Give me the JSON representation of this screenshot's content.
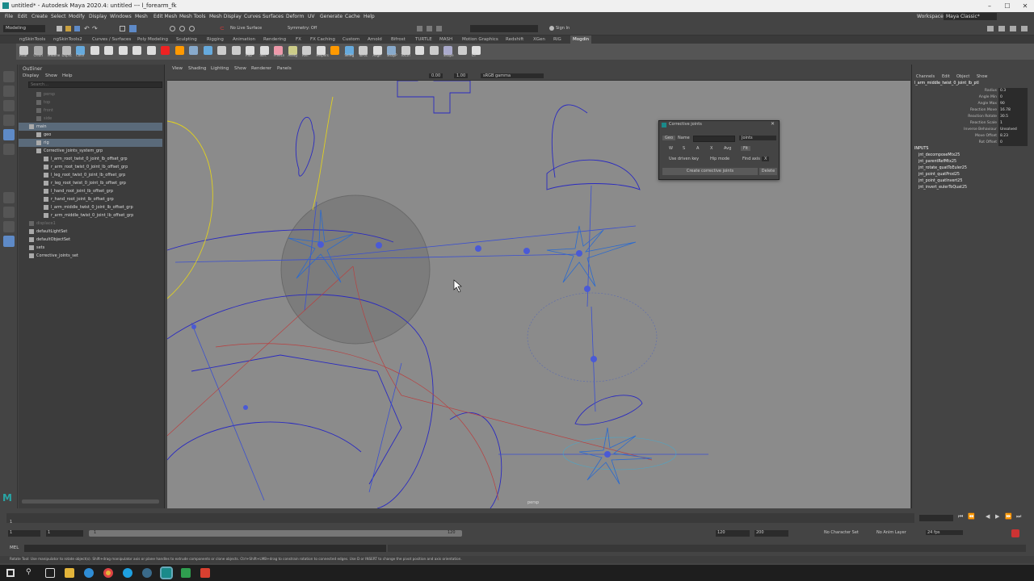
{
  "window": {
    "title": "untitled* - Autodesk Maya 2020.4: untitled   ---   l_forearm_fk",
    "minimize": "–",
    "maximize": "☐",
    "close": "✕"
  },
  "menu": [
    "File",
    "Edit",
    "Create",
    "Select",
    "Modify",
    "Display",
    "Windows",
    "Mesh",
    "Edit Mesh",
    "Mesh Tools",
    "Mesh Display",
    "Curves",
    "Surfaces",
    "Deform",
    "UV",
    "Generate",
    "Cache",
    "Help"
  ],
  "workspace": {
    "label": "Workspace :",
    "value": "Maya Classic*"
  },
  "statusline": {
    "mode": "Modeling",
    "live_surface": "No Live Surface",
    "symmetry": "Symmetry: Off",
    "sign_in": "Sign In"
  },
  "shelf_tabs": [
    "ngSkinTools",
    "ngSkinTools2",
    "Curves / Surfaces",
    "Poly Modeling",
    "Sculpting",
    "Rigging",
    "Animation",
    "Rendering",
    "FX",
    "FX Caching",
    "Custom",
    "Arnold",
    "Bifrost",
    "TURTLE",
    "MASH",
    "Motion Graphics",
    "Redshift",
    "XGen",
    "RIG",
    "Mogdin"
  ],
  "shelf_labels": [
    "Pillar",
    "Clean",
    "MName",
    "Duplic",
    "Color",
    "",
    "",
    "",
    "",
    "",
    "",
    "",
    "",
    "",
    "",
    "",
    "PSD",
    "Sort",
    "FreeLn",
    "AlEdg",
    "Refl",
    "Helpers",
    "",
    "SelHg",
    "ToFoc",
    "Align",
    "SnapP",
    "ToCtrl",
    "",
    "",
    "Shape",
    "",
    "CT"
  ],
  "outliner": {
    "title": "Outliner",
    "menu": [
      "Display",
      "Show",
      "Help"
    ],
    "search_placeholder": "Search...",
    "rows": [
      {
        "indent": 2,
        "label": "persp",
        "dim": true
      },
      {
        "indent": 2,
        "label": "top",
        "dim": true
      },
      {
        "indent": 2,
        "label": "front",
        "dim": true
      },
      {
        "indent": 2,
        "label": "side",
        "dim": true
      },
      {
        "indent": 1,
        "label": "main",
        "selected": true
      },
      {
        "indent": 2,
        "label": "geo"
      },
      {
        "indent": 2,
        "label": "rig",
        "selected": true
      },
      {
        "indent": 2,
        "label": "Corrective_joints_system_grp"
      },
      {
        "indent": 3,
        "label": "l_arm_root_twist_0_joint_lb_offset_grp"
      },
      {
        "indent": 3,
        "label": "r_arm_root_twist_0_joint_lb_offset_grp"
      },
      {
        "indent": 3,
        "label": "l_leg_root_twist_0_joint_lb_offset_grp"
      },
      {
        "indent": 3,
        "label": "r_leg_root_twist_0_joint_lb_offset_grp"
      },
      {
        "indent": 3,
        "label": "l_hand_root_joint_lb_offset_grp"
      },
      {
        "indent": 3,
        "label": "r_hand_root_joint_lb_offset_grp"
      },
      {
        "indent": 3,
        "label": "l_arm_middle_twist_0_joint_lb_offset_grp"
      },
      {
        "indent": 3,
        "label": "r_arm_middle_twist_0_joint_lb_offset_grp"
      },
      {
        "indent": 1,
        "label": "displace1",
        "dim": true
      },
      {
        "indent": 1,
        "label": "defaultLightSet"
      },
      {
        "indent": 1,
        "label": "defaultObjectSet"
      },
      {
        "indent": 1,
        "label": "sets"
      },
      {
        "indent": 1,
        "label": "Corrective_joints_set"
      }
    ]
  },
  "viewport": {
    "menu": [
      "View",
      "Shading",
      "Lighting",
      "Show",
      "Renderer",
      "Panels"
    ],
    "value1": "0.00",
    "value2": "1.00",
    "colorspace": "sRGB gamma",
    "camera_label": "persp"
  },
  "dialog": {
    "title": "Corrective joints",
    "geo_btn": "Geo",
    "name_label": "Name",
    "name_value": "",
    "type_value": "Joints",
    "axes": [
      "W",
      "S",
      "A",
      "X",
      "Avg"
    ],
    "fit_btn": "Fit",
    "use_driven_key": "Use driven key",
    "hip_mode": "Hip mode",
    "find_axis_label": "Find axis",
    "find_axis_value": "X",
    "create_btn": "Create corrective joints",
    "delete_btn": "Delete"
  },
  "channelbox": {
    "menu": [
      "Channels",
      "Edit",
      "Object",
      "Show"
    ],
    "node_name": "l_arm_middle_twist_0_joint_lb_ptl",
    "attributes": [
      {
        "name": "Radius",
        "value": "0.3"
      },
      {
        "name": "Angle Min",
        "value": "0"
      },
      {
        "name": "Angle Max",
        "value": "90"
      },
      {
        "name": "Reaction Move",
        "value": "16.78"
      },
      {
        "name": "Reaction Rotate",
        "value": "30.5"
      },
      {
        "name": "Reaction Scale",
        "value": "1"
      },
      {
        "name": "Inverse Behaviour",
        "value": "Unsolved"
      },
      {
        "name": "Move Offset",
        "value": "8.23"
      },
      {
        "name": "Rot Offset",
        "value": "0"
      }
    ],
    "inputs_title": "INPUTS",
    "inputs": [
      "jnt_decomposeMtx25",
      "jnt_parentRefMtx25",
      "jnt_rotate_quatToEuler25",
      "jnt_point_quatProd25",
      "jnt_point_quatInvert25",
      "jnt_invert_eulerToQuat25"
    ]
  },
  "timeslider": {
    "ticks": [
      "1",
      "",
      "",
      "",
      "",
      "",
      "",
      "",
      "",
      "",
      "",
      "",
      "",
      "",
      "",
      "",
      "",
      "",
      "",
      "",
      "",
      "",
      "",
      "",
      "",
      "",
      "",
      "",
      "",
      "",
      "",
      "",
      "",
      "",
      "",
      "",
      "",
      "",
      "",
      "",
      "",
      "",
      "",
      "",
      "",
      "",
      "",
      "",
      "",
      "",
      "",
      "",
      "",
      "",
      "",
      "",
      "",
      "",
      "",
      "",
      "",
      "",
      "",
      "",
      "",
      "",
      "",
      "",
      "",
      "",
      "",
      "",
      "",
      "",
      "",
      "",
      "",
      "",
      "",
      "",
      "",
      "",
      "",
      "",
      "",
      "",
      "",
      "",
      "",
      "",
      "",
      "",
      "",
      "",
      "",
      "",
      "",
      "",
      "",
      "",
      "",
      "",
      "",
      "",
      "",
      "",
      "",
      "",
      "",
      "",
      "",
      "",
      "",
      "",
      ""
    ],
    "current_frame": "1"
  },
  "rangeslider": {
    "start": "1",
    "inner_start": "1",
    "range_start": "1",
    "range_end": "120",
    "end": "120",
    "max": "200",
    "character_set": "No Character Set",
    "anim_layer": "No Anim Layer",
    "fps": "24 fps"
  },
  "cmdline": {
    "label": "MEL"
  },
  "helpline": "Rotate Tool: Use manipulator to rotate object(s). Shift+drag manipulator axis or plane handles to extrude components or clone objects. Ctrl+Shift+LMB+drag to constrain rotation to connected edges. Use D or INSERT to change the pivot position and axis orientation."
}
